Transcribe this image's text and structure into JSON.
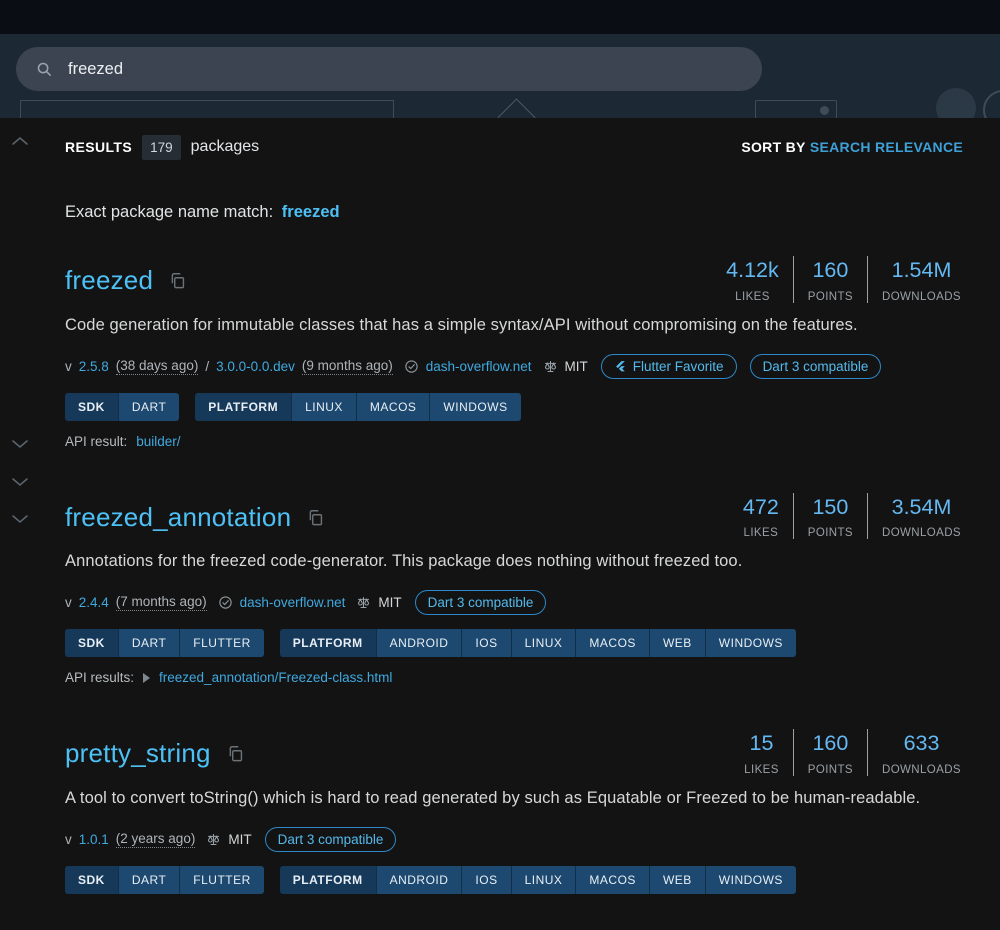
{
  "search": {
    "value": "freezed"
  },
  "results_bar": {
    "results_label": "RESULTS",
    "count": "179",
    "packages_label": "packages",
    "sort_by_label": "SORT BY",
    "sort_value": "SEARCH RELEVANCE"
  },
  "exact_match": {
    "label": "Exact package name match:",
    "package": "freezed"
  },
  "metric_labels": {
    "likes": "LIKES",
    "points": "POINTS",
    "downloads": "DOWNLOADS"
  },
  "tag_labels": {
    "sdk": "SDK",
    "platform": "PLATFORM"
  },
  "badge_labels": {
    "flutter_favorite": "Flutter Favorite",
    "dart3": "Dart 3 compatible"
  },
  "colors": {
    "header_bg": "#1c2834",
    "content_bg": "#131313",
    "link_blue": "#3fa9e0",
    "title_blue": "#4dc1f6",
    "metric_blue": "#64b9f2",
    "tag_bg": "#1d4970",
    "tag_label_bg": "#16395a",
    "pill_border": "#2e87c8"
  },
  "packages": [
    {
      "name": "freezed",
      "likes": "4.12k",
      "points": "160",
      "downloads": "1.54M",
      "description": "Code generation for immutable classes that has a simple syntax/API without compromising on the features.",
      "meta": {
        "version_prefix": "v",
        "version": "2.5.8",
        "version_age": "(38 days ago)",
        "separator": "/",
        "prerelease": "3.0.0-0.0.dev",
        "prerelease_age": "(9 months ago)",
        "publisher": "dash-overflow.net",
        "license": "MIT"
      },
      "sdk_tags": [
        "DART"
      ],
      "platform_tags": [
        "LINUX",
        "MACOS",
        "WINDOWS"
      ],
      "api": {
        "label": "API result:",
        "link": "builder/"
      }
    },
    {
      "name": "freezed_annotation",
      "likes": "472",
      "points": "150",
      "downloads": "3.54M",
      "description": "Annotations for the freezed code-generator. This package does nothing without freezed too.",
      "meta": {
        "version_prefix": "v",
        "version": "2.4.4",
        "version_age": "(7 months ago)",
        "publisher": "dash-overflow.net",
        "license": "MIT"
      },
      "sdk_tags": [
        "DART",
        "FLUTTER"
      ],
      "platform_tags": [
        "ANDROID",
        "IOS",
        "LINUX",
        "MACOS",
        "WEB",
        "WINDOWS"
      ],
      "api": {
        "label": "API results:",
        "link": "freezed_annotation/Freezed-class.html"
      }
    },
    {
      "name": "pretty_string",
      "likes": "15",
      "points": "160",
      "downloads": "633",
      "description": "A tool to convert toString() which is hard to read generated by such as Equatable or Freezed to be human-readable.",
      "meta": {
        "version_prefix": "v",
        "version": "1.0.1",
        "version_age": "(2 years ago)",
        "license": "MIT"
      },
      "sdk_tags": [
        "DART",
        "FLUTTER"
      ],
      "platform_tags": [
        "ANDROID",
        "IOS",
        "LINUX",
        "MACOS",
        "WEB",
        "WINDOWS"
      ]
    }
  ]
}
